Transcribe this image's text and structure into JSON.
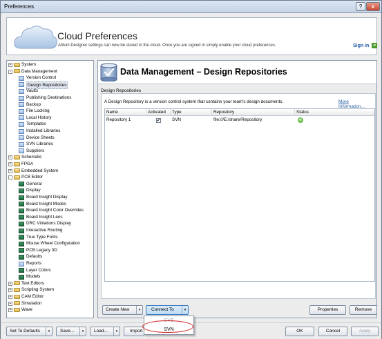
{
  "window": {
    "title": "Preferences",
    "help_label": "?",
    "close_label": "x"
  },
  "cloud": {
    "title": "Cloud Preferences",
    "description": "Altium Designer settings can now be stored in the cloud. Once you are signed in simply enable your cloud preferences.",
    "sign_in": "Sign in"
  },
  "tree": {
    "items": [
      {
        "label": "System",
        "level": 0,
        "icon": "folder-icon",
        "expander": "+"
      },
      {
        "label": "Data Management",
        "level": 0,
        "icon": "folder-icon",
        "expander": "-"
      },
      {
        "label": "Version Control",
        "level": 1,
        "icon": "page-icon"
      },
      {
        "label": "Design Repositories",
        "level": 1,
        "icon": "page-icon",
        "selected": true
      },
      {
        "label": "Vaults",
        "level": 1,
        "icon": "page-icon"
      },
      {
        "label": "Publishing Destinations",
        "level": 1,
        "icon": "page-icon"
      },
      {
        "label": "Backup",
        "level": 1,
        "icon": "page-icon"
      },
      {
        "label": "File Locking",
        "level": 1,
        "icon": "page-icon"
      },
      {
        "label": "Local History",
        "level": 1,
        "icon": "page-icon"
      },
      {
        "label": "Templates",
        "level": 1,
        "icon": "page-icon"
      },
      {
        "label": "Installed Libraries",
        "level": 1,
        "icon": "page-icon"
      },
      {
        "label": "Device Sheets",
        "level": 1,
        "icon": "page-icon"
      },
      {
        "label": "SVN Libraries",
        "level": 1,
        "icon": "page-icon"
      },
      {
        "label": "Suppliers",
        "level": 1,
        "icon": "page-icon"
      },
      {
        "label": "Schematic",
        "level": 0,
        "icon": "folder-icon",
        "expander": "+"
      },
      {
        "label": "FPGA",
        "level": 0,
        "icon": "folder-icon",
        "expander": "+"
      },
      {
        "label": "Embedded System",
        "level": 0,
        "icon": "folder-icon",
        "expander": "+"
      },
      {
        "label": "PCB Editor",
        "level": 0,
        "icon": "folder-icon",
        "expander": "-"
      },
      {
        "label": "General",
        "level": 1,
        "icon": "pcb-icon"
      },
      {
        "label": "Display",
        "level": 1,
        "icon": "pcb-icon"
      },
      {
        "label": "Board Insight Display",
        "level": 1,
        "icon": "pcb-icon"
      },
      {
        "label": "Board Insight Modes",
        "level": 1,
        "icon": "pcb-icon"
      },
      {
        "label": "Board Insight Color Overrides",
        "level": 1,
        "icon": "pcb-icon"
      },
      {
        "label": "Board Insight Lens",
        "level": 1,
        "icon": "pcb-icon"
      },
      {
        "label": "DRC Violations Display",
        "level": 1,
        "icon": "pcb-icon"
      },
      {
        "label": "Interactive Routing",
        "level": 1,
        "icon": "pcb-icon"
      },
      {
        "label": "True Type Fonts",
        "level": 1,
        "icon": "pcb-icon"
      },
      {
        "label": "Mouse Wheel Configuration",
        "level": 1,
        "icon": "pcb-icon"
      },
      {
        "label": "PCB Legacy 3D",
        "level": 1,
        "icon": "pcb-icon"
      },
      {
        "label": "Defaults",
        "level": 1,
        "icon": "pcb-icon"
      },
      {
        "label": "Reports",
        "level": 1,
        "icon": "page-icon"
      },
      {
        "label": "Layer Colors",
        "level": 1,
        "icon": "pcb-icon"
      },
      {
        "label": "Models",
        "level": 1,
        "icon": "pcb-icon"
      },
      {
        "label": "Text Editors",
        "level": 0,
        "icon": "folder-icon",
        "expander": "+"
      },
      {
        "label": "Scripting System",
        "level": 0,
        "icon": "folder-icon",
        "expander": "+"
      },
      {
        "label": "CAM Editor",
        "level": 0,
        "icon": "folder-icon",
        "expander": "+"
      },
      {
        "label": "Simulation",
        "level": 0,
        "icon": "folder-icon",
        "expander": "+"
      },
      {
        "label": "Wave",
        "level": 0,
        "icon": "folder-icon",
        "expander": "+"
      }
    ]
  },
  "panel": {
    "title": "Data Management – Design Repositories",
    "group_label": "Design Repositories",
    "description": "A Design Repository is a version control system that contains your team's design documents.",
    "more_info": "More Information...",
    "columns": [
      "Name",
      "Activated",
      "Type",
      "Repository",
      "Status"
    ],
    "rows": [
      {
        "name": "Repository 1",
        "activated": "✔",
        "type": "SVN",
        "repository": "file:///E:/share/Repository",
        "status": "✔"
      }
    ],
    "buttons": {
      "create_new": "Create New",
      "connect_to": "Connect To",
      "properties": "Properties",
      "remove": "Remove"
    },
    "dropdown_arrow": "▾"
  },
  "connect_menu": {
    "items": [
      {
        "label": "CVS",
        "disabled": true
      },
      {
        "label": "SVN",
        "disabled": false
      }
    ]
  },
  "footer": {
    "set_to_defaults": "Set To Defaults",
    "save": "Save...",
    "load": "Load...",
    "import": "Import F",
    "ok": "OK",
    "cancel": "Cancel",
    "apply": "Apply"
  }
}
